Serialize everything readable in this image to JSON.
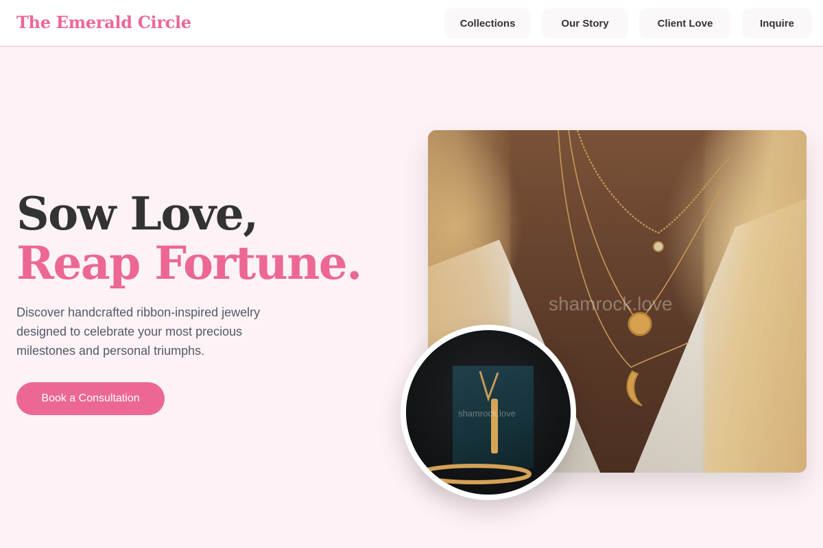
{
  "header": {
    "brand": "The Emerald Circle",
    "nav": [
      {
        "label": "Collections"
      },
      {
        "label": "Our Story"
      },
      {
        "label": "Client Love"
      },
      {
        "label": "Inquire"
      }
    ]
  },
  "hero": {
    "title_line1": "Sow Love,",
    "title_line2": "Reap Fortune.",
    "description": "Discover handcrafted ribbon-inspired jewelry designed to celebrate your most precious milestones and personal triumphs.",
    "cta_label": "Book a Consultation"
  },
  "images": {
    "main_watermark": "shamrock.love",
    "inset_watermark": "shamrock.love"
  },
  "colors": {
    "accent": "#ec6794",
    "background": "#fdf2f5",
    "text_dark": "#333333",
    "text_muted": "#525a6a"
  }
}
